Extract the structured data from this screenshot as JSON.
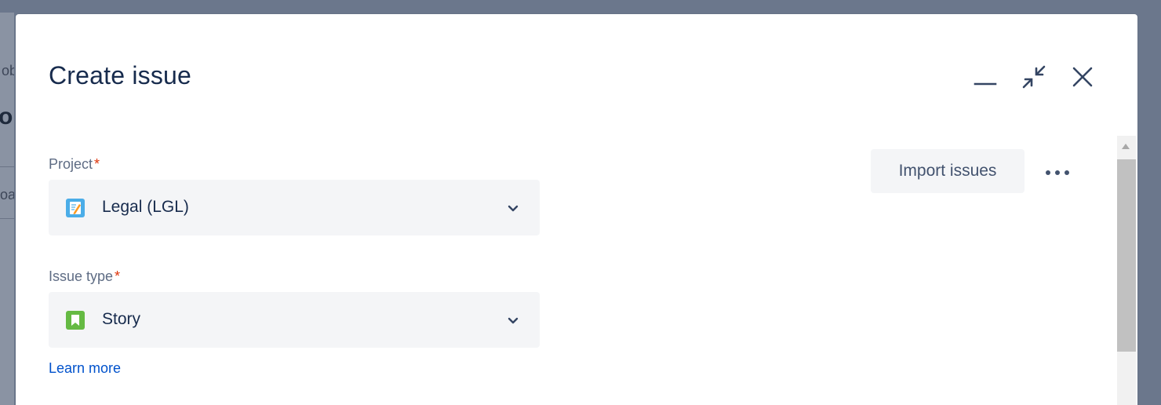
{
  "background": {
    "fragments": [
      "ob",
      "o",
      "oa"
    ]
  },
  "modal": {
    "title": "Create issue",
    "header_icons": [
      "minimize-icon",
      "shrink-icon",
      "close-icon"
    ]
  },
  "fields": {
    "project": {
      "label": "Project",
      "required_mark": "*",
      "value": "Legal (LGL)",
      "icon": "legal-project-icon"
    },
    "issue_type": {
      "label": "Issue type",
      "required_mark": "*",
      "value": "Story",
      "icon": "story-icon"
    }
  },
  "links": {
    "learn_more": "Learn more"
  },
  "actions": {
    "import_label": "Import issues",
    "more_icon": "more-icon"
  },
  "colors": {
    "title": "#172b4d",
    "label": "#5e6c84",
    "required": "#de350b",
    "link": "#0052cc",
    "field_bg": "#f4f5f7",
    "story_green": "#65ba43",
    "project_icon_bg": "#4bade8"
  }
}
